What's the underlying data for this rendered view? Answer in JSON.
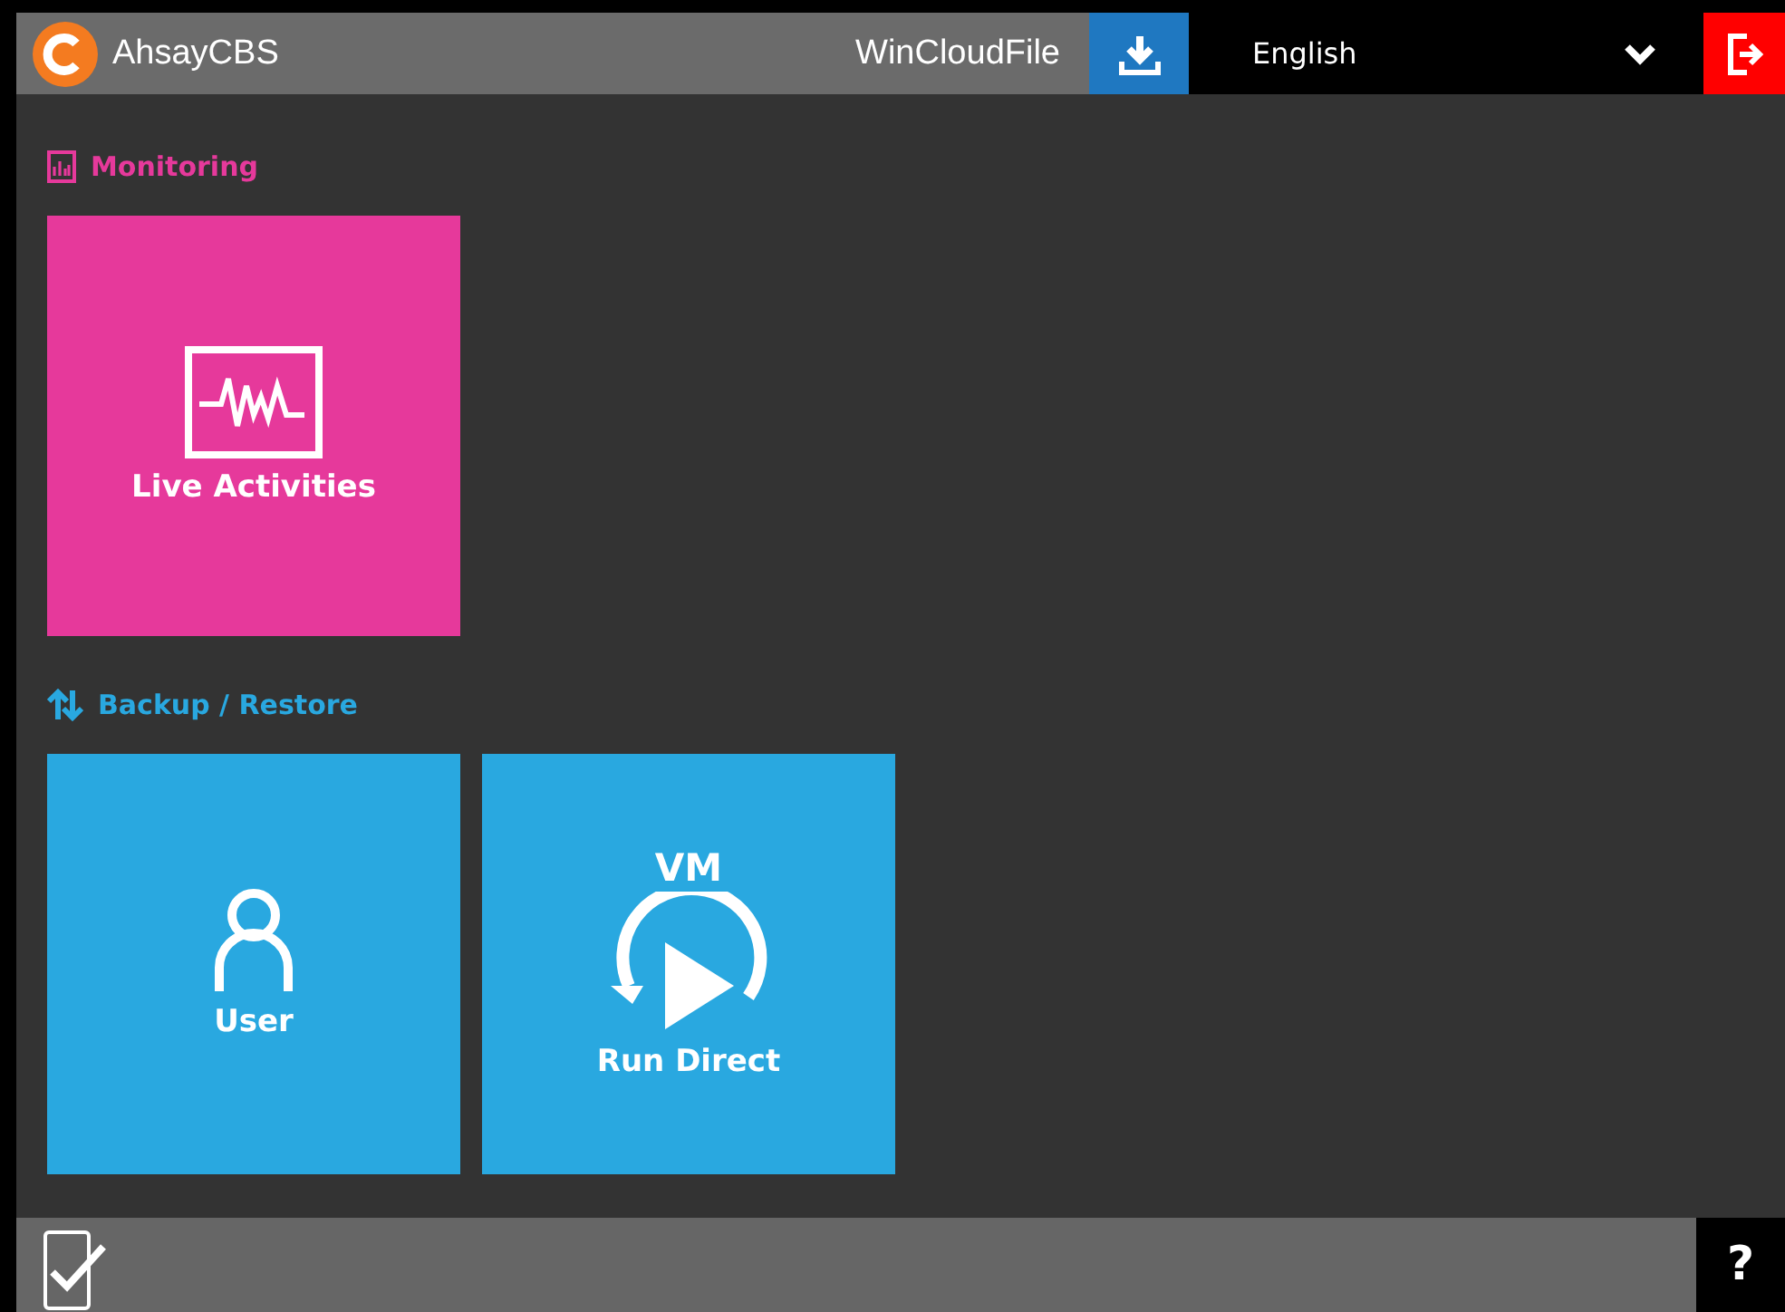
{
  "header": {
    "brand": "AhsayCBS",
    "host": "WinCloudFile",
    "language": "English"
  },
  "sections": [
    {
      "title": "Monitoring",
      "kind": "monitoring",
      "color": "#e6399b",
      "tiles": [
        {
          "kind": "activity",
          "label": "Live Activities"
        }
      ]
    },
    {
      "title": "Backup / Restore",
      "kind": "backup",
      "color": "#29a8e0",
      "tiles": [
        {
          "kind": "user",
          "label": "User"
        },
        {
          "kind": "run-direct",
          "label": "Run Direct",
          "badge": "VM"
        }
      ]
    }
  ],
  "footer": {
    "help": "?"
  }
}
